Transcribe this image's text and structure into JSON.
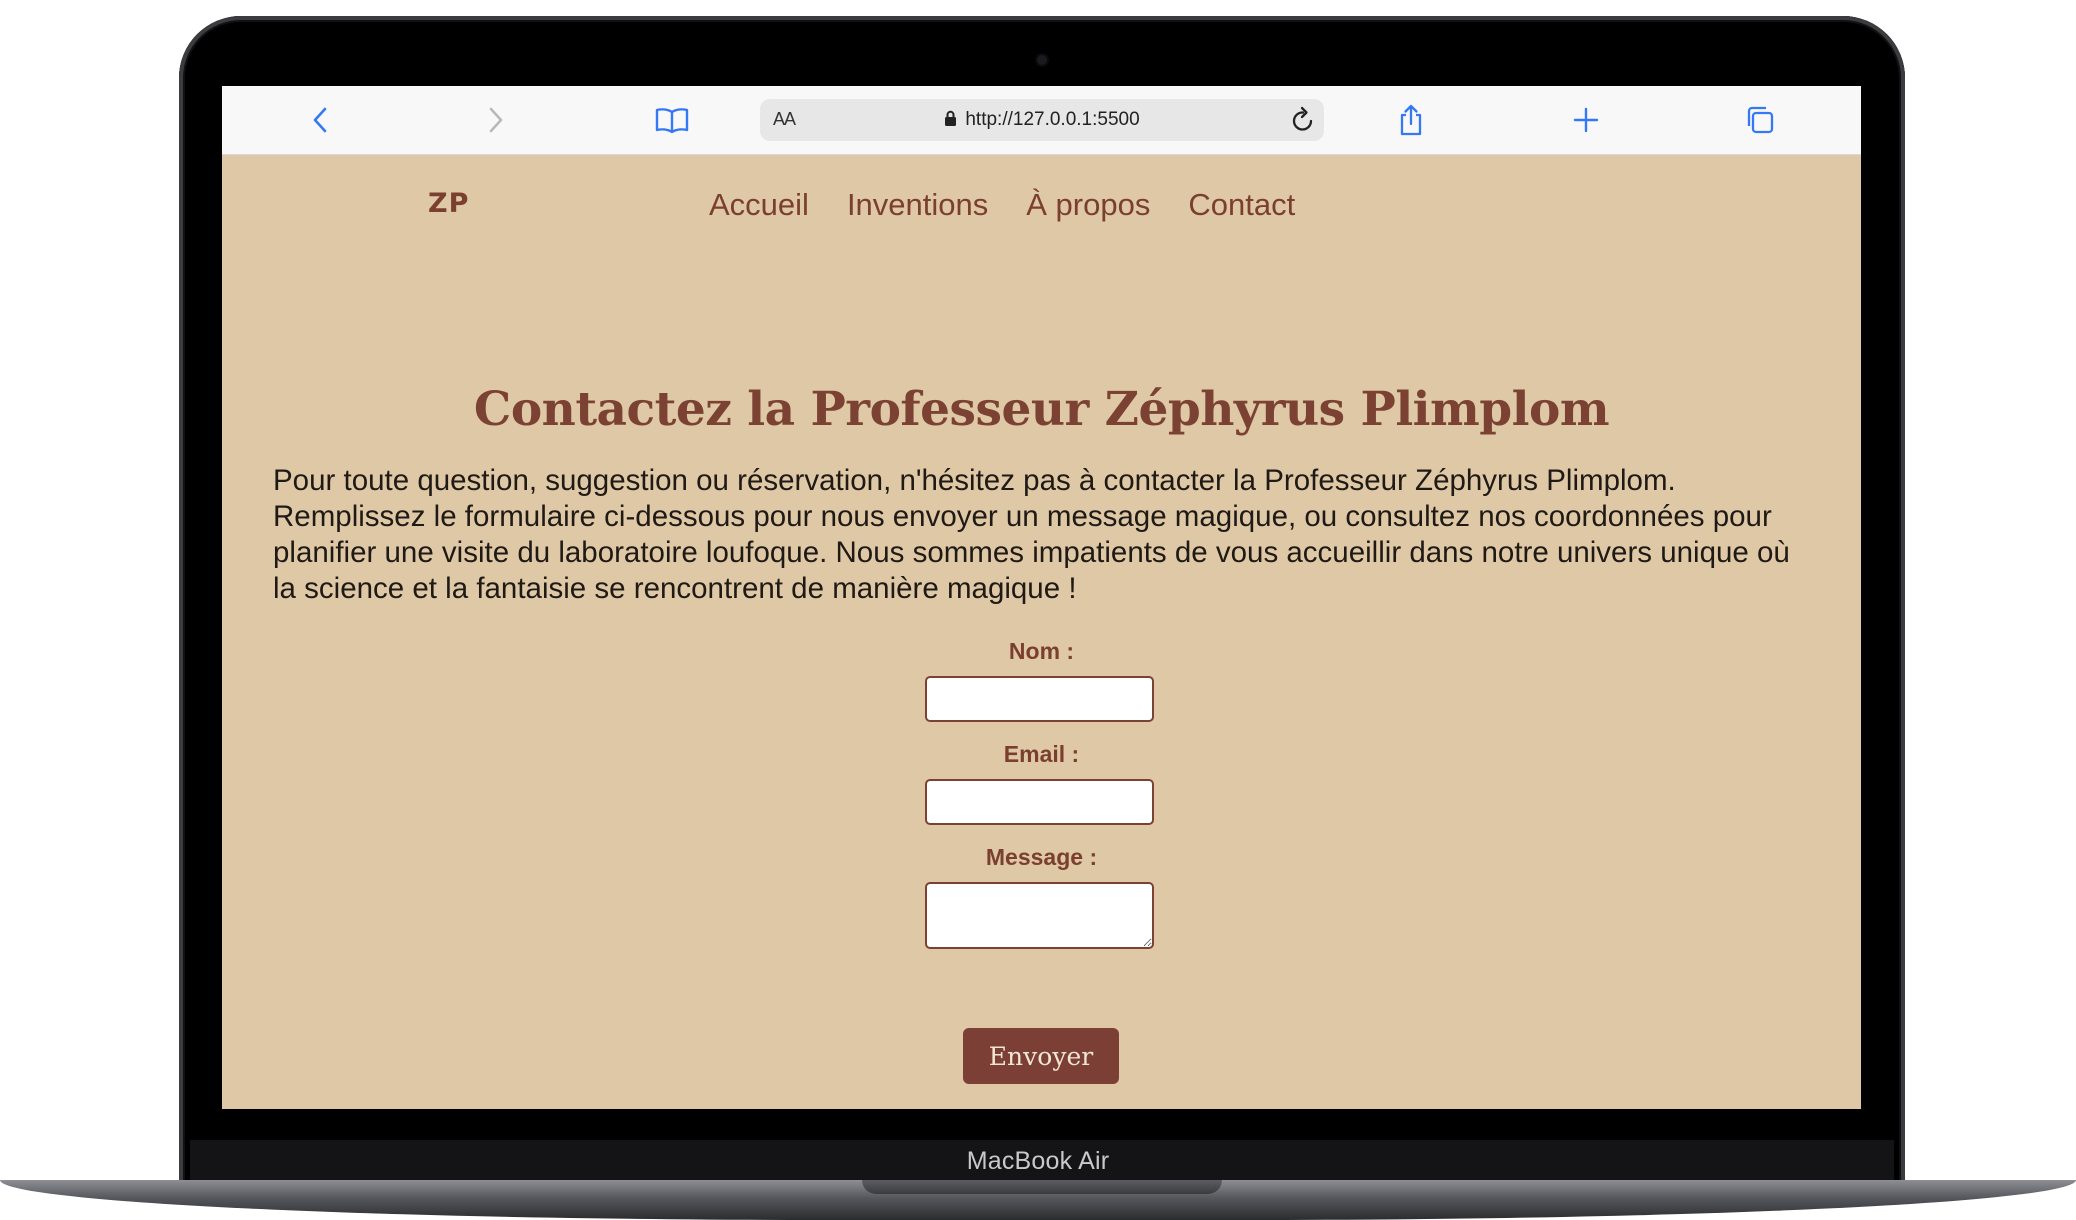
{
  "browser": {
    "text_size_label": "AA",
    "url": "http://127.0.0.1:5500",
    "icons": [
      "chevron-left-icon",
      "chevron-right-icon",
      "book-icon",
      "lock-icon",
      "reload-icon",
      "share-icon",
      "plus-icon",
      "tabs-icon"
    ]
  },
  "site": {
    "logo": "ZP",
    "nav": [
      "Accueil",
      "Inventions",
      "À propos",
      "Contact"
    ]
  },
  "content": {
    "title": "Contactez la Professeur Zéphyrus Plimplom",
    "intro": "Pour toute question, suggestion ou réservation, n'hésitez pas à contacter la Professeur Zéphyrus Plimplom. Remplissez le formulaire ci-dessous pour nous envoyer un message magique, ou consultez nos coordonnées pour planifier une visite du laboratoire loufoque. Nous sommes impatients de vous accueillir dans notre univers unique où la science et la fantaisie se rencontrent de manière magique !"
  },
  "form": {
    "name_label": "Nom :",
    "name_value": "",
    "email_label": "Email :",
    "email_value": "",
    "message_label": "Message :",
    "message_value": "",
    "submit_label": "Envoyer"
  },
  "device": {
    "label": "MacBook Air"
  },
  "colors": {
    "page_background": "#dfc8a5",
    "accent": "#7b3f2f",
    "button": "#7b3f36",
    "toolbar_blue": "#3478f6"
  }
}
